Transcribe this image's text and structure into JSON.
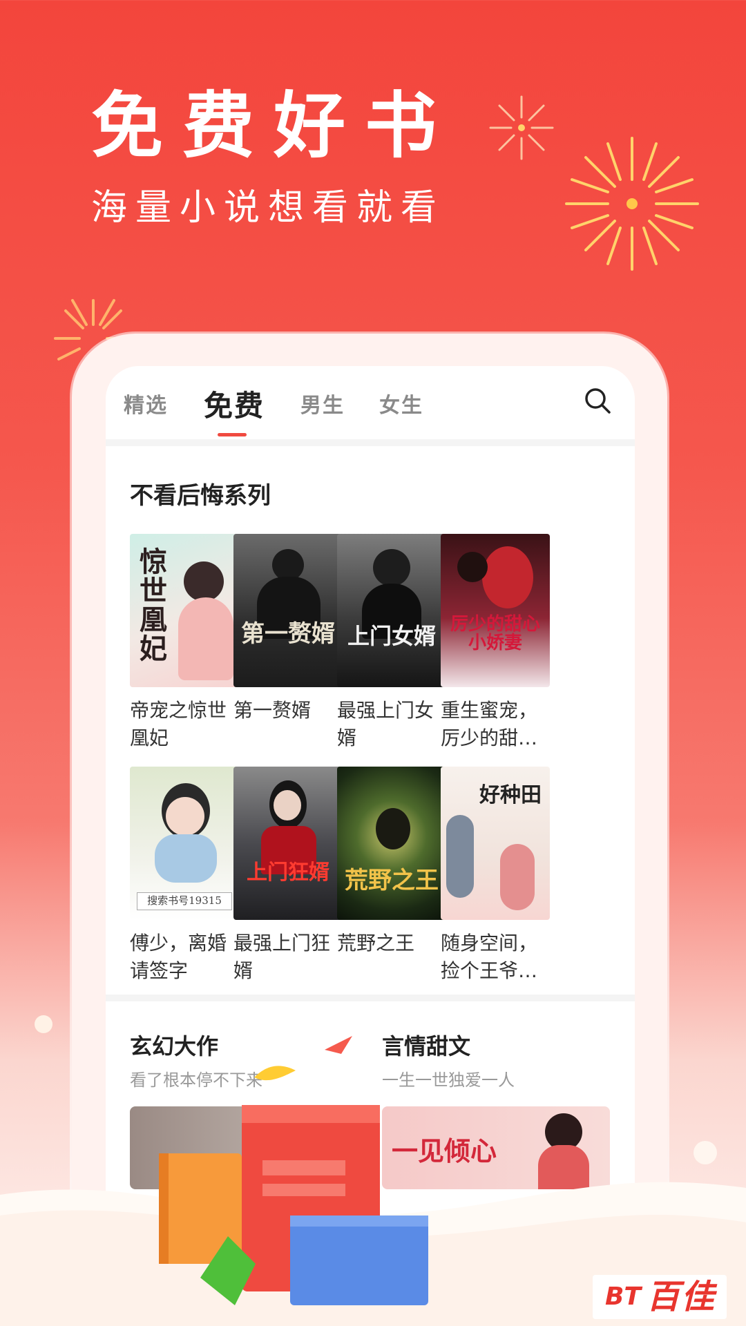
{
  "promo": {
    "headline": "免费好书",
    "subheadline": "海量小说想看就看"
  },
  "tabs": [
    {
      "label": "精选",
      "active": false
    },
    {
      "label": "免费",
      "active": true
    },
    {
      "label": "男生",
      "active": false
    },
    {
      "label": "女生",
      "active": false
    }
  ],
  "section": {
    "title": "不看后悔系列"
  },
  "books": [
    {
      "title": "帝宠之惊世凰妃",
      "cover_text": "惊世凰妃",
      "cover_theme": "#d8eee8"
    },
    {
      "title": "第一赘婿",
      "cover_text": "第一赘婿",
      "cover_theme": "#3a3a3a"
    },
    {
      "title": "最强上门女婿",
      "cover_text": "上门女婿",
      "cover_theme": "#2b2b2b"
    },
    {
      "title": "重生蜜宠，厉少的甜心小娇妻",
      "cover_text": "厉少的甜心小娇妻",
      "cover_theme": "#7a1d2a"
    },
    {
      "title": "傅少，离婚请签字",
      "cover_text": "搜索书号19315",
      "cover_theme": "#e4ead8"
    },
    {
      "title": "最强上门狂婿",
      "cover_text": "上门狂婿",
      "cover_theme": "#3b3b40"
    },
    {
      "title": "荒野之王",
      "cover_text": "荒野之王",
      "cover_theme": "#1f3520"
    },
    {
      "title": "随身空间，捡个王爷种田",
      "cover_text": "好种田",
      "cover_theme": "#f3ece6"
    }
  ],
  "categories": [
    {
      "title": "玄幻大作",
      "subtitle": "看了根本停不下来"
    },
    {
      "title": "言情甜文",
      "subtitle": "一生一世独爱一人",
      "banner_text": "一见倾心"
    }
  ],
  "logo": {
    "mark": "BT",
    "text": "百佳"
  },
  "colors": {
    "accent": "#f04a40",
    "background_top": "#f3453c"
  },
  "icons": [
    "search-icon",
    "firework-icon",
    "book-stack-icon",
    "logo-icon"
  ]
}
